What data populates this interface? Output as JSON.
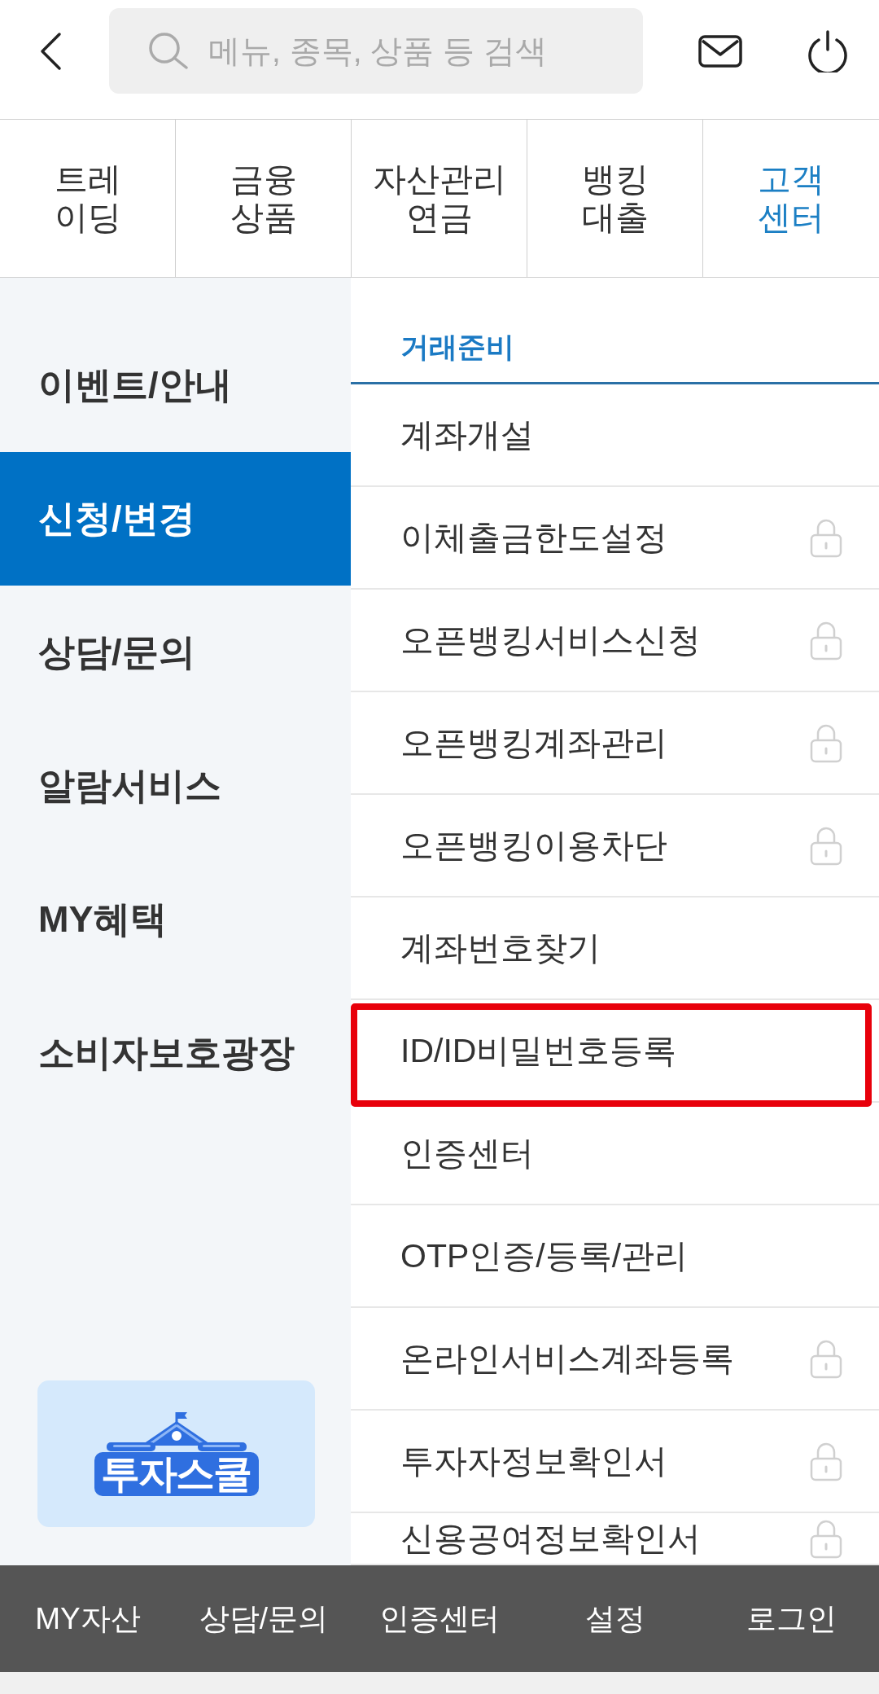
{
  "top_bar": {
    "search": {
      "placeholder": "메뉴, 종목, 상품 등 검색"
    }
  },
  "tabs": [
    {
      "lines": [
        "트레",
        "이딩"
      ],
      "selected": false
    },
    {
      "lines": [
        "금융",
        "상품"
      ],
      "selected": false
    },
    {
      "lines": [
        "자산관리",
        "연금"
      ],
      "selected": false
    },
    {
      "lines": [
        "뱅킹",
        "대출"
      ],
      "selected": false
    },
    {
      "lines": [
        "고객",
        "센터"
      ],
      "selected": true
    }
  ],
  "sidebar": {
    "items": [
      {
        "label": "이벤트/안내",
        "selected": false
      },
      {
        "label": "신청/변경",
        "selected": true
      },
      {
        "label": "상담/문의",
        "selected": false
      },
      {
        "label": "알람서비스",
        "selected": false
      },
      {
        "label": "MY혜택",
        "selected": false
      },
      {
        "label": "소비자보호광장",
        "selected": false
      }
    ],
    "banner": {
      "text": "투자스쿨"
    }
  },
  "menu": {
    "section_title": "거래준비",
    "items": [
      {
        "label": "계좌개설",
        "locked": false,
        "highlighted": false
      },
      {
        "label": "이체출금한도설정",
        "locked": true,
        "highlighted": false
      },
      {
        "label": "오픈뱅킹서비스신청",
        "locked": true,
        "highlighted": false
      },
      {
        "label": "오픈뱅킹계좌관리",
        "locked": true,
        "highlighted": false
      },
      {
        "label": "오픈뱅킹이용차단",
        "locked": true,
        "highlighted": false
      },
      {
        "label": "계좌번호찾기",
        "locked": false,
        "highlighted": false
      },
      {
        "label": "ID/ID비밀번호등록",
        "locked": false,
        "highlighted": true
      },
      {
        "label": "인증센터",
        "locked": false,
        "highlighted": false
      },
      {
        "label": "OTP인증/등록/관리",
        "locked": false,
        "highlighted": false
      },
      {
        "label": "온라인서비스계좌등록",
        "locked": true,
        "highlighted": false
      },
      {
        "label": "투자자정보확인서",
        "locked": true,
        "highlighted": false
      },
      {
        "label": "신용공여정보확인서",
        "locked": true,
        "highlighted": false
      }
    ]
  },
  "bottom_nav": {
    "items": [
      "MY자산",
      "상담/문의",
      "인증센터",
      "설정",
      "로그인"
    ]
  }
}
